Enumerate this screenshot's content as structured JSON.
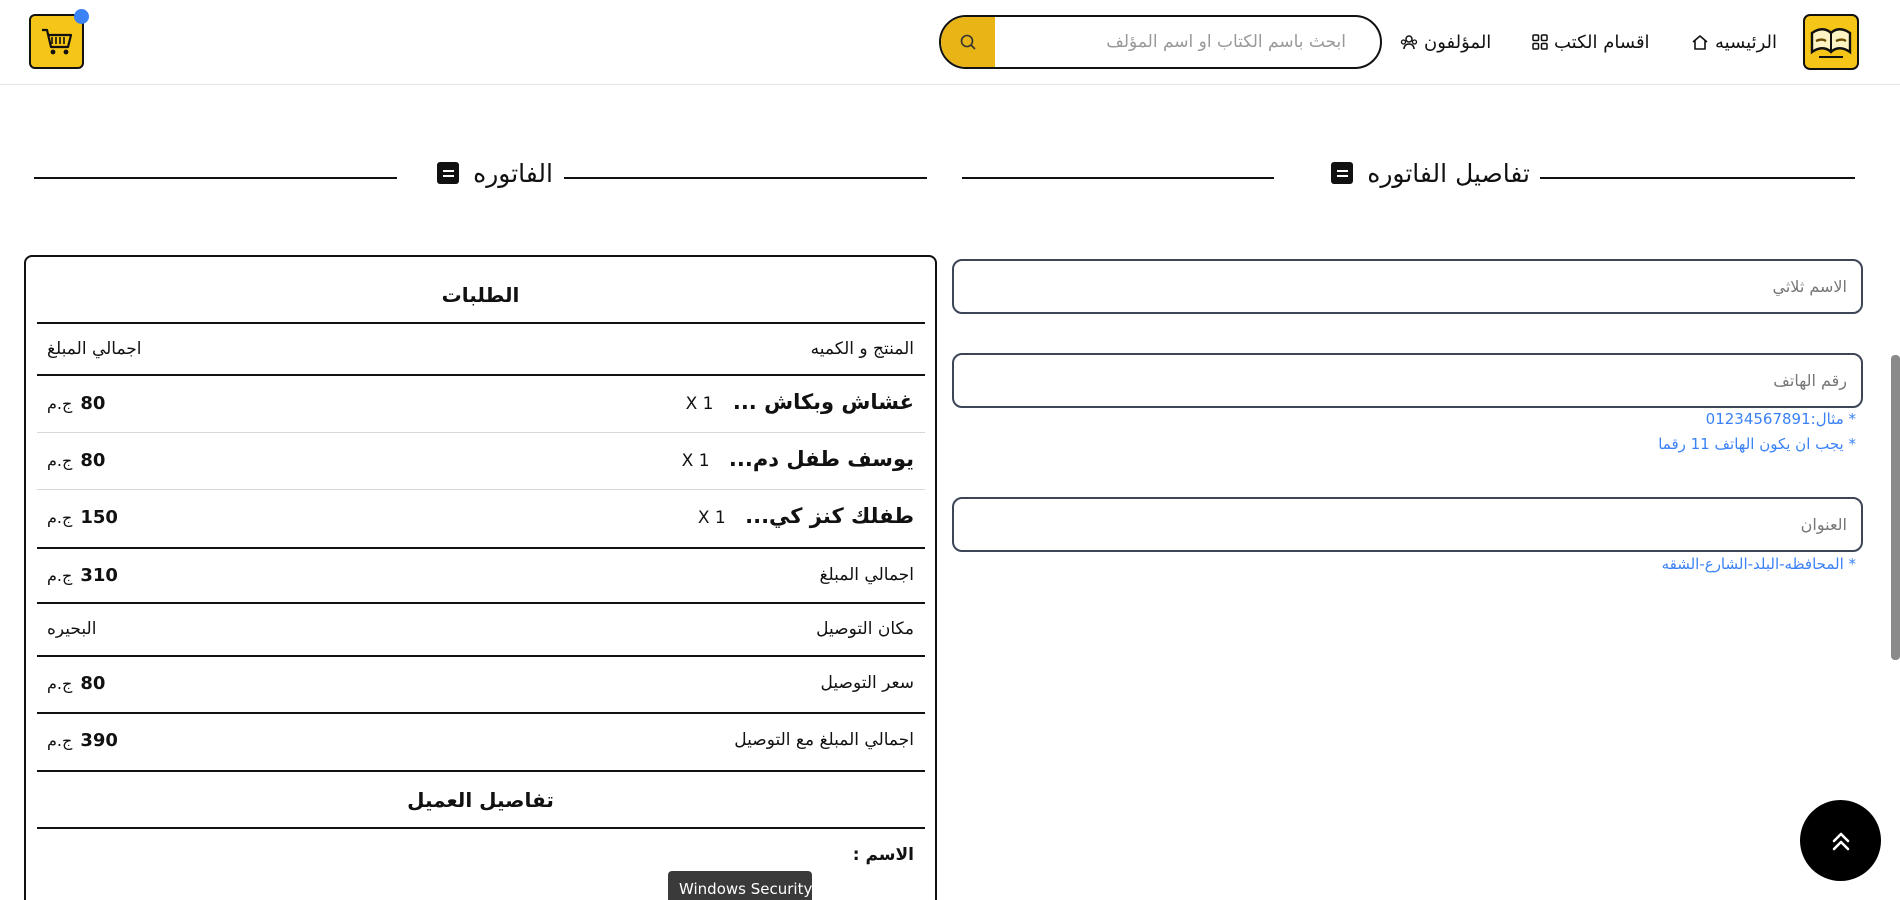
{
  "header": {
    "nav_home": "الرئيسيه",
    "nav_categories": "اقسام الكتب",
    "nav_authors": "المؤلفون",
    "search_placeholder": "ابحث باسم الكتاب او اسم المؤلف"
  },
  "invoice_details": {
    "heading": "تفاصيل الفاتوره",
    "name_placeholder": "الاسم ثلاثي",
    "phone_placeholder": "رقم الهاتف",
    "phone_hint_1": "* مثال:01234567891",
    "phone_hint_2": "* يجب ان يكون الهاتف 11 رقما",
    "address_placeholder": "العنوان",
    "address_hint": "* المحافظه-البلد-الشارع-الشقه"
  },
  "invoice": {
    "heading": "الفاتوره",
    "orders_title": "الطلبات",
    "col_product": "المنتج و الكميه",
    "col_total": "اجمالي المبلغ",
    "currency": "ج.م",
    "items": [
      {
        "name": "غشاش وبكاش ...",
        "qty": "X  1",
        "amount": "80"
      },
      {
        "name": "يوسف طفل دم...",
        "qty": "X  1",
        "amount": "80"
      },
      {
        "name": "طفلك كنز كي...",
        "qty": "X  1",
        "amount": "150"
      }
    ],
    "subtotal_label": "اجمالي المبلغ",
    "subtotal": "310",
    "location_label": "مكان التوصيل",
    "location": "البحيره",
    "delivery_label": "سعر التوصيل",
    "delivery": "80",
    "grand_label": "اجمالي المبلغ مع التوصيل",
    "grand": "390",
    "customer_title": "تفاصيل العميل",
    "customer_name_label": "الاسم :"
  },
  "tooltip": "Windows Security",
  "colors": {
    "accent": "#f5c518",
    "search_btn": "#e8b416",
    "hint": "#3b82f6"
  }
}
